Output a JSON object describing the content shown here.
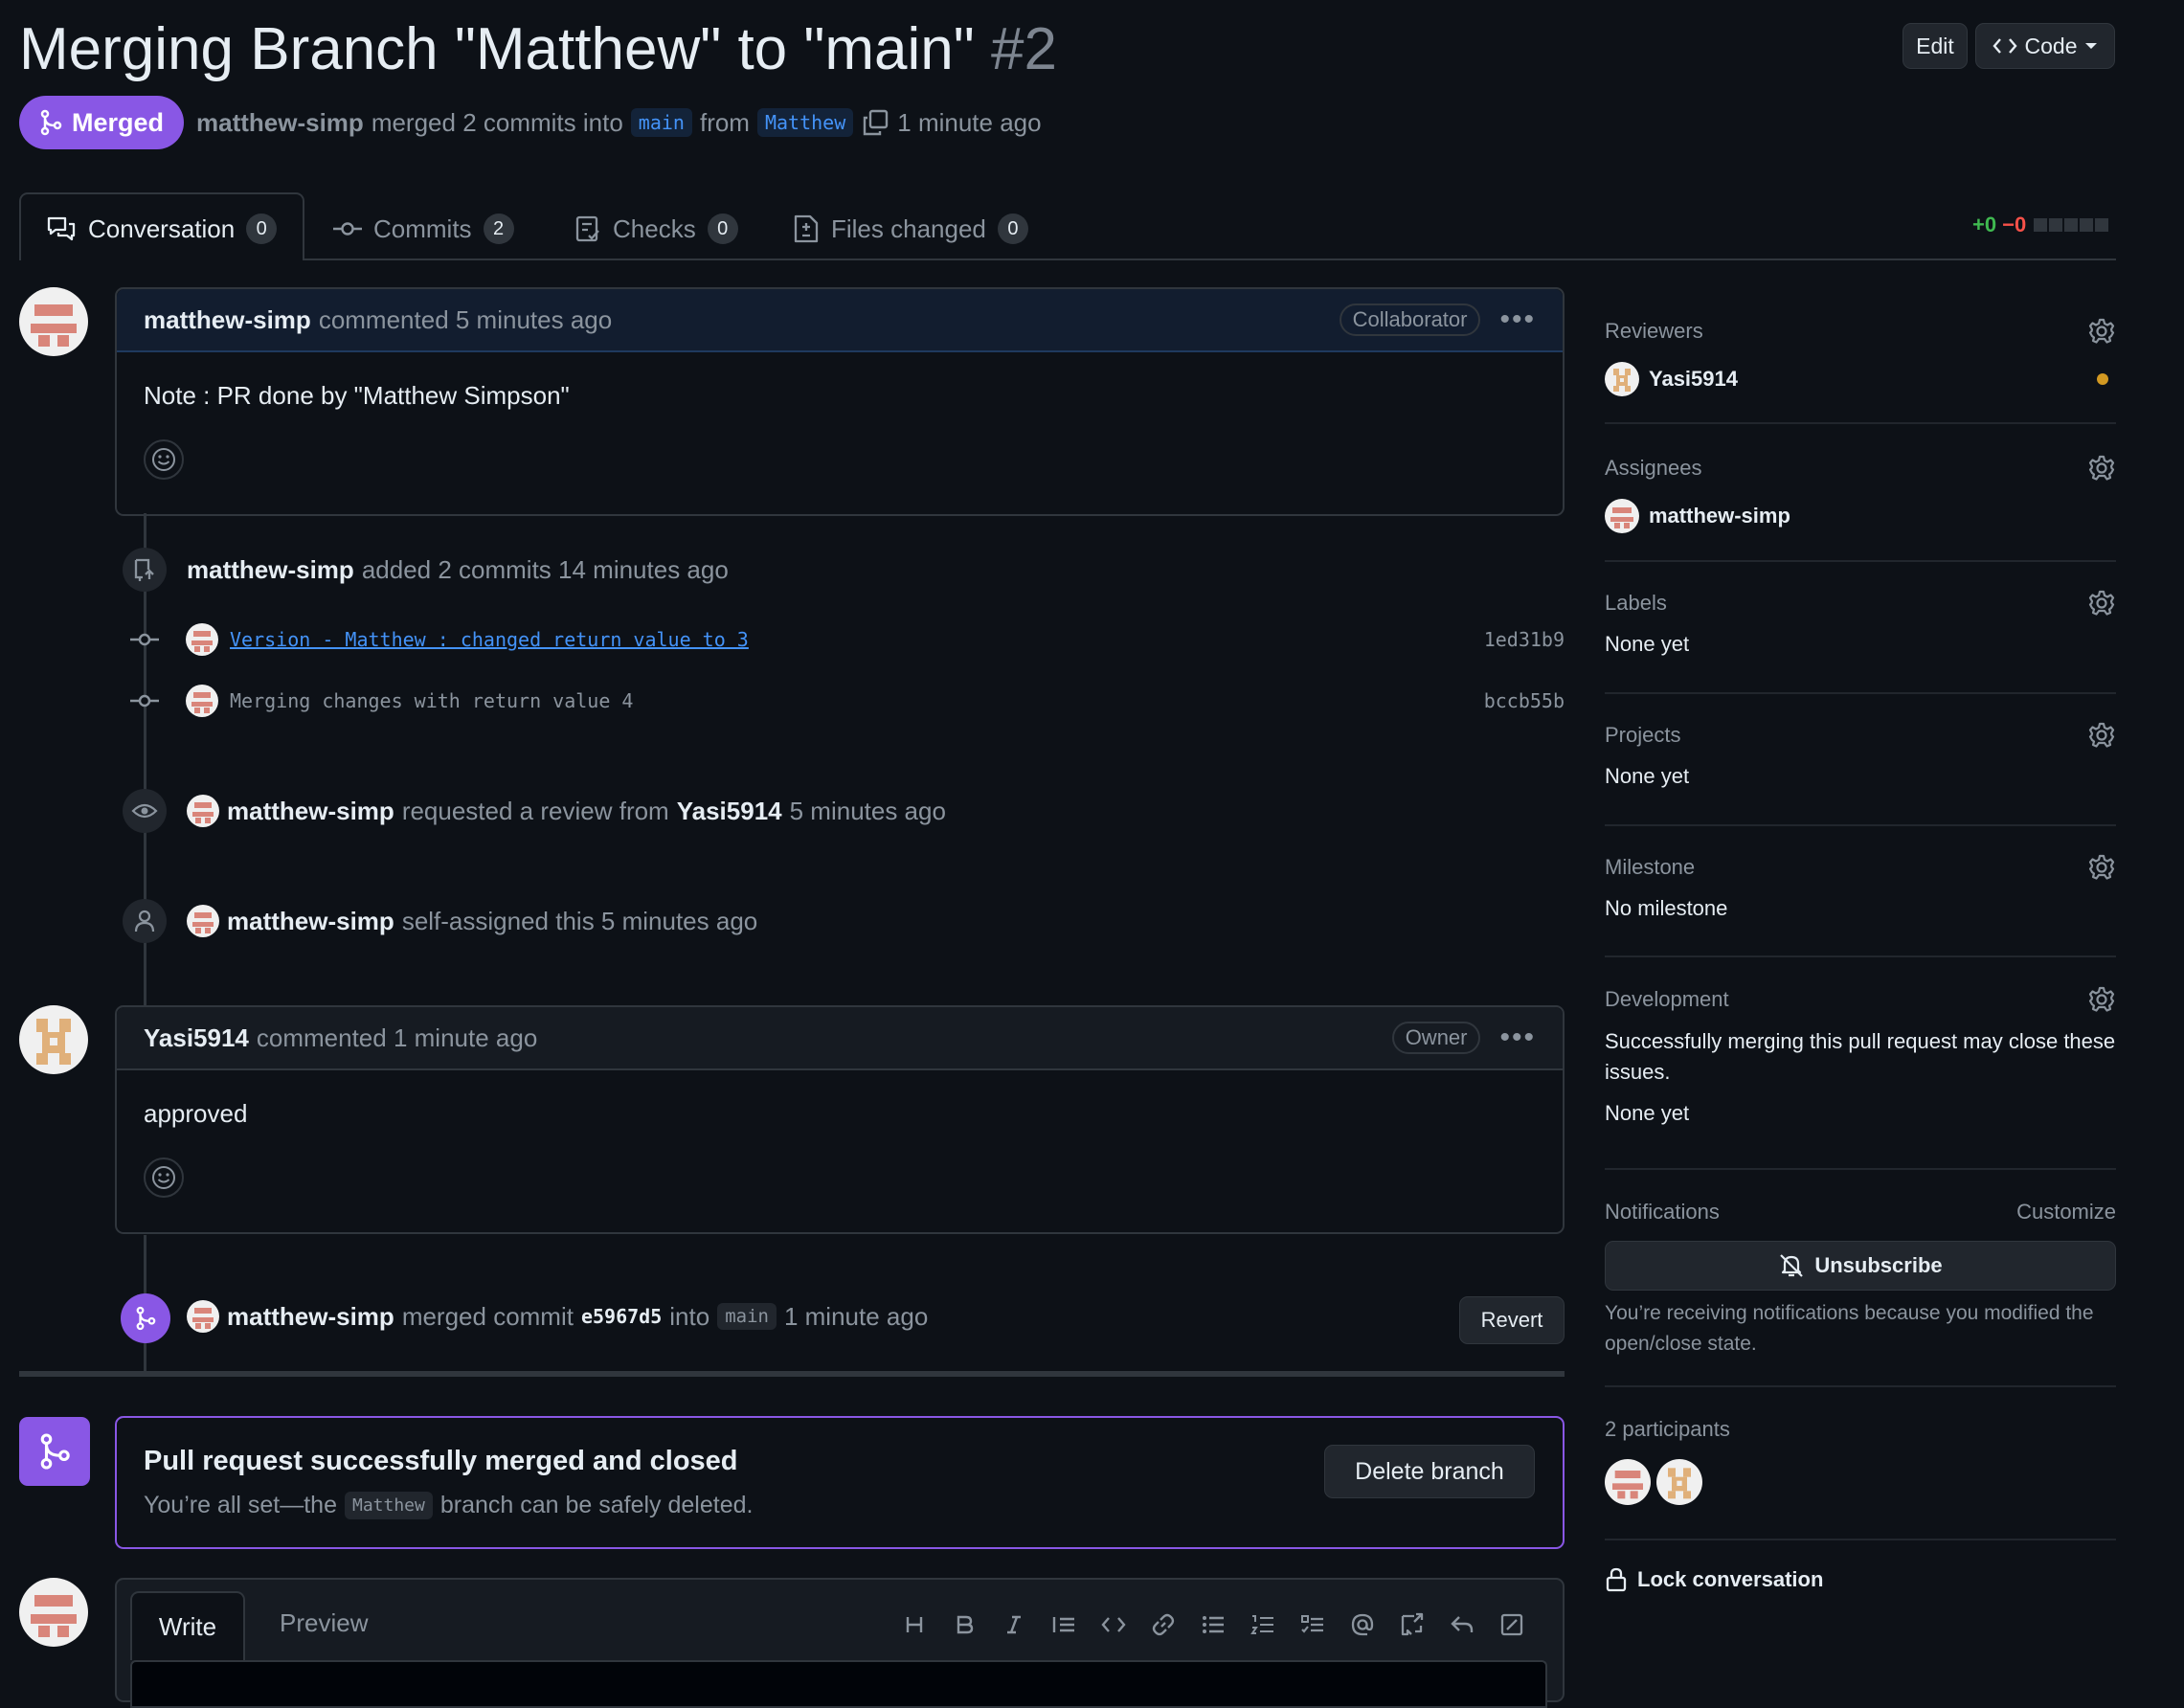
{
  "header": {
    "title": "Merging Branch \"Matthew\" to \"main\"",
    "number": "#2",
    "edit_label": "Edit",
    "code_label": "Code"
  },
  "status": {
    "badge": "Merged",
    "author": "matthew-simp",
    "merged_text": "merged 2 commits into",
    "base_branch": "main",
    "from_text": "from",
    "head_branch": "Matthew",
    "time": "1 minute ago"
  },
  "tabs": [
    {
      "label": "Conversation",
      "count": "0"
    },
    {
      "label": "Commits",
      "count": "2"
    },
    {
      "label": "Checks",
      "count": "0"
    },
    {
      "label": "Files changed",
      "count": "0"
    }
  ],
  "diffstat": {
    "added": "+0",
    "removed": "−0"
  },
  "comment1": {
    "author": "matthew-simp",
    "meta": "commented 5 minutes ago",
    "role": "Collaborator",
    "body": "Note : PR done by \"Matthew Simpson\""
  },
  "commits_event": {
    "author": "matthew-simp",
    "text": "added 2 commits 14 minutes ago",
    "commits": [
      {
        "message": "Version - Matthew : changed return value to 3",
        "sha": "1ed31b9"
      },
      {
        "message": "Merging changes with return value 4",
        "sha": "bccb55b"
      }
    ]
  },
  "review_event": {
    "author": "matthew-simp",
    "text": "requested a review from",
    "reviewer": "Yasi5914",
    "time": "5 minutes ago"
  },
  "assign_event": {
    "author": "matthew-simp",
    "text": "self-assigned this 5 minutes ago"
  },
  "comment2": {
    "author": "Yasi5914",
    "meta": "commented 1 minute ago",
    "role": "Owner",
    "body": "approved"
  },
  "merge_event": {
    "author": "matthew-simp",
    "text": "merged commit",
    "sha": "e5967d5",
    "into": "into",
    "branch": "main",
    "time": "1 minute ago",
    "revert_label": "Revert"
  },
  "merge_box": {
    "title": "Pull request successfully merged and closed",
    "pre": "You’re all set—the",
    "branch": "Matthew",
    "post": "branch can be safely deleted.",
    "delete_label": "Delete branch"
  },
  "editor": {
    "write_tab": "Write",
    "preview_tab": "Preview"
  },
  "sidebar": {
    "reviewers": {
      "label": "Reviewers",
      "name": "Yasi5914"
    },
    "assignees": {
      "label": "Assignees",
      "name": "matthew-simp"
    },
    "labels": {
      "label": "Labels",
      "value": "None yet"
    },
    "projects": {
      "label": "Projects",
      "value": "None yet"
    },
    "milestone": {
      "label": "Milestone",
      "value": "No milestone"
    },
    "development": {
      "label": "Development",
      "desc": "Successfully merging this pull request may close these issues.",
      "value": "None yet"
    },
    "notifications": {
      "label": "Notifications",
      "customize": "Customize",
      "button": "Unsubscribe",
      "reason": "You’re receiving notifications because you modified the open/close state."
    },
    "participants": {
      "label": "2 participants"
    },
    "lock": "Lock conversation"
  },
  "colors": {
    "accent": "#8957e5",
    "link": "#4493f8",
    "bg": "#0d1117",
    "pending": "#d29922"
  }
}
